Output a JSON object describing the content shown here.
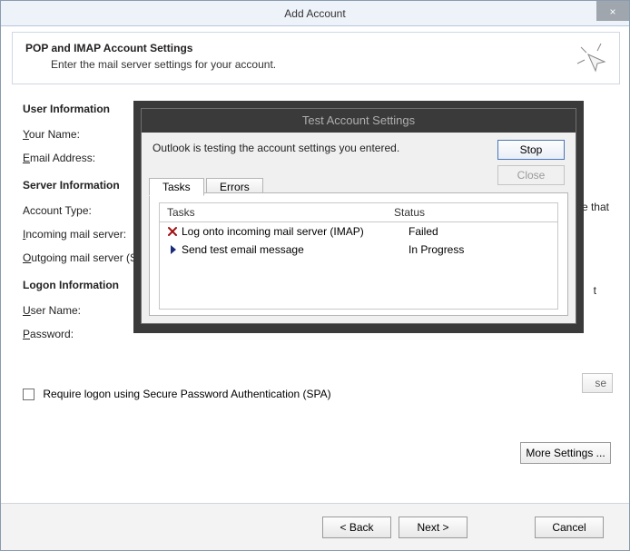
{
  "window": {
    "title": "Add Account",
    "close_glyph": "×"
  },
  "header": {
    "title": "POP and IMAP Account Settings",
    "subtitle": "Enter the mail server settings for your account."
  },
  "sections": {
    "user_info": "User Information",
    "server_info": "Server Information",
    "logon_info": "Logon Information"
  },
  "fields": {
    "your_name_u": "Y",
    "your_name_rest": "our Name:",
    "email_u": "E",
    "email_rest": "mail Address:",
    "account_type": "Account Type:",
    "incoming_u": "I",
    "incoming_rest": "ncoming mail server:",
    "outgoing_u": "O",
    "outgoing_rest": "utgoing mail server (S",
    "user_name_u": "U",
    "user_name_rest": "ser Name:",
    "password_u": "P",
    "password_rest": "assword:",
    "spa_u": "q",
    "spa_pre": "Re",
    "spa_rest": "uire logon using Secure Password Authentication (SPA)"
  },
  "truncated_right": {
    "line1": "e that",
    "line2": "t",
    "line3": "se"
  },
  "buttons": {
    "more_settings_u": "M",
    "more_settings_rest": "ore Settings ...",
    "back": "< Back",
    "next_u": "N",
    "next_rest": "ext >",
    "cancel": "Cancel"
  },
  "modal": {
    "title": "Test Account Settings",
    "message": "Outlook is testing the account settings you entered.",
    "stop_u": "S",
    "stop_rest": "top",
    "close": "Close",
    "tab_tasks": "Tasks",
    "tab_errors": "Errors",
    "col_tasks": "Tasks",
    "col_status": "Status",
    "tasks": [
      {
        "name": "Log onto incoming mail server (IMAP)",
        "status": "Failed",
        "icon": "fail"
      },
      {
        "name": "Send test email message",
        "status": "In Progress",
        "icon": "progress"
      }
    ]
  }
}
